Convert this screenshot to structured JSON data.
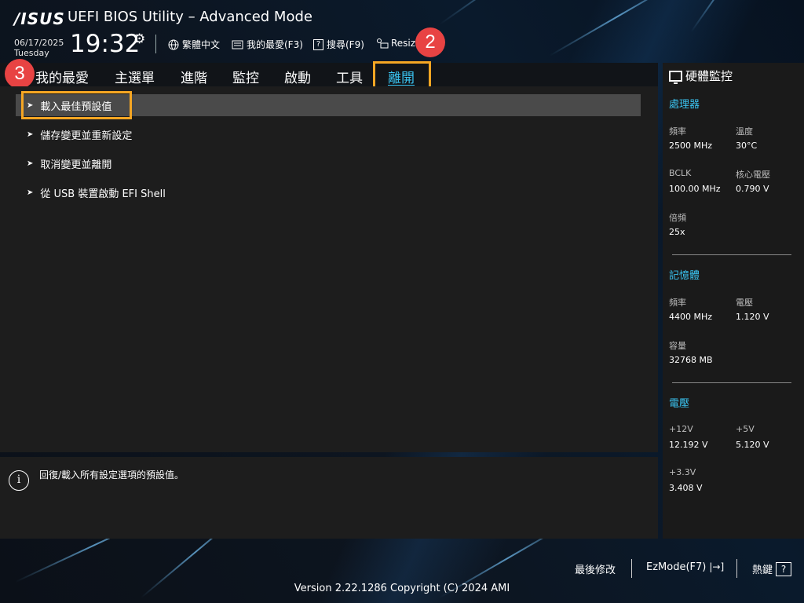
{
  "header": {
    "logo": "/ISUS",
    "title": "UEFI BIOS Utility – Advanced Mode",
    "date": "06/17/2025",
    "day": "Tuesday",
    "time": "19:32",
    "items": [
      {
        "icon": "globe-icon",
        "label": "繁體中文"
      },
      {
        "icon": "favorites-icon",
        "label": "我的最愛(F3)"
      },
      {
        "icon": "search-icon",
        "label": "搜尋(F9)"
      },
      {
        "icon": "resize-icon",
        "label": "Resiz"
      }
    ]
  },
  "badges": [
    "2",
    "3"
  ],
  "tabs": [
    "我的最愛",
    "主選單",
    "進階",
    "監控",
    "啟動",
    "工具",
    "離開"
  ],
  "active_tab": "離開",
  "menu": [
    {
      "label": "載入最佳預設值",
      "selected": true
    },
    {
      "label": "儲存變更並重新設定",
      "selected": false
    },
    {
      "label": "取消變更並離開",
      "selected": false
    },
    {
      "label": "從 USB 裝置啟動 EFI Shell",
      "selected": false
    }
  ],
  "help": {
    "text": "回復/載入所有設定選項的預設值。"
  },
  "hw_monitor": {
    "title": "硬體監控",
    "cpu": {
      "title": "處理器",
      "freq_label": "頻率",
      "freq": "2500 MHz",
      "temp_label": "溫度",
      "temp": "30°C",
      "bclk_label": "BCLK",
      "bclk": "100.00 MHz",
      "vcore_label": "核心電壓",
      "vcore": "0.790 V",
      "ratio_label": "倍頻",
      "ratio": "25x"
    },
    "memory": {
      "title": "記憶體",
      "freq_label": "頻率",
      "freq": "4400 MHz",
      "volt_label": "電壓",
      "volt": "1.120 V",
      "cap_label": "容量",
      "cap": "32768 MB"
    },
    "voltage": {
      "title": "電壓",
      "v12_label": "+12V",
      "v12": "12.192 V",
      "v5_label": "+5V",
      "v5": "5.120 V",
      "v33_label": "+3.3V",
      "v33": "3.408 V"
    }
  },
  "footer": {
    "last_modified": "最後修改",
    "ezmode": "EzMode(F7)",
    "hotkeys": "熱鍵",
    "version": "Version 2.22.1286 Copyright (C) 2024 AMI"
  },
  "colors": {
    "accent": "#3ac3f0",
    "highlight": "#f5a623",
    "badge": "#e84343"
  }
}
